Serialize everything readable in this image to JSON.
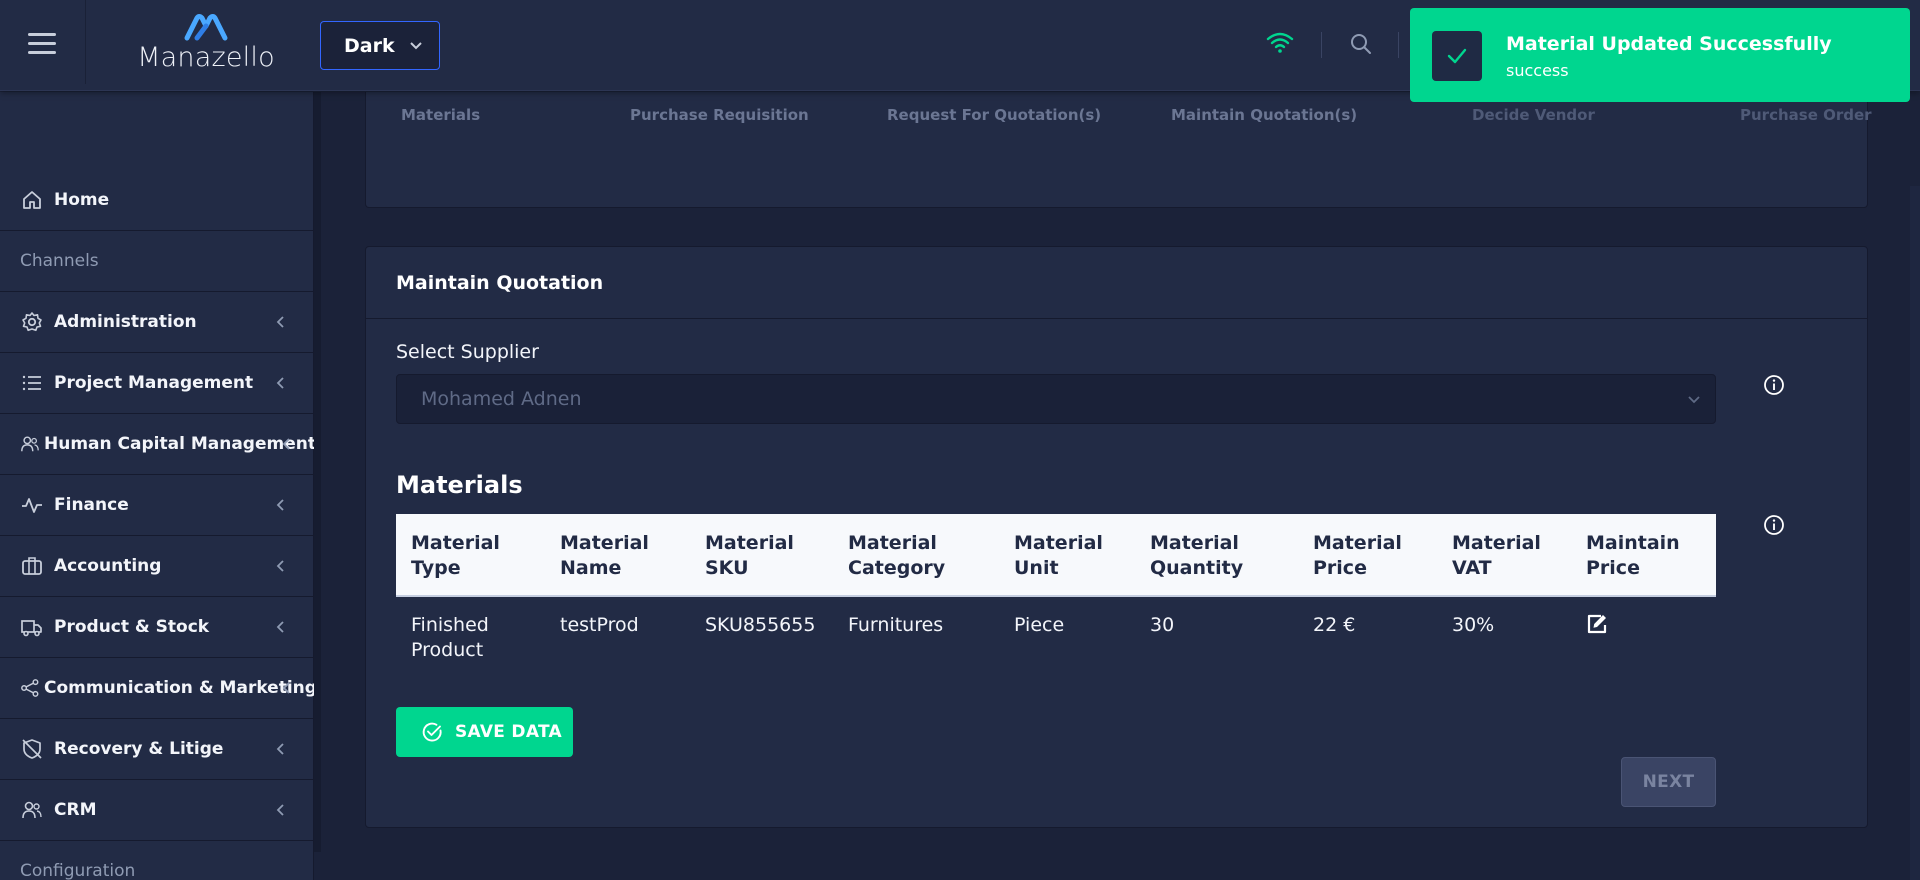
{
  "header": {
    "logo_text": "Manazello",
    "theme_label": "Dark"
  },
  "toast": {
    "title": "Material Updated Successfully",
    "message": "success",
    "color": "#00d68f"
  },
  "sidebar": {
    "items": [
      {
        "label": "Home",
        "icon": "home-icon"
      },
      {
        "label": "Channels",
        "icon": null
      },
      {
        "label": "Administration",
        "icon": "gear-icon"
      },
      {
        "label": "Project Management",
        "icon": "list-icon"
      },
      {
        "label": "Human Capital Management",
        "icon": "people-icon"
      },
      {
        "label": "Finance",
        "icon": "activity-icon"
      },
      {
        "label": "Accounting",
        "icon": "briefcase-icon"
      },
      {
        "label": "Product & Stock",
        "icon": "truck-icon"
      },
      {
        "label": "Communication & Marketing",
        "icon": "share-icon"
      },
      {
        "label": "Recovery & Litige",
        "icon": "shield-off-icon"
      },
      {
        "label": "CRM",
        "icon": "people-icon"
      },
      {
        "label": "Configuration",
        "icon": null
      }
    ]
  },
  "steps": [
    "Materials",
    "Purchase Requisition",
    "Request For Quotation(s)",
    "Maintain Quotation(s)",
    "Decide Vendor",
    "Purchase Order"
  ],
  "quotation": {
    "card_title": "Maintain Quotation",
    "supplier_label": "Select Supplier",
    "supplier_value": "Mohamed Adnen",
    "materials_title": "Materials",
    "columns": [
      [
        "Material",
        "Type"
      ],
      [
        "Material",
        "Name"
      ],
      [
        "Material",
        "SKU"
      ],
      [
        "Material",
        "Category"
      ],
      [
        "Material",
        "Unit"
      ],
      [
        "Material",
        "Quantity"
      ],
      [
        "Material",
        "Price"
      ],
      [
        "Material",
        "VAT"
      ],
      [
        "Maintain",
        "Price"
      ]
    ],
    "rows": [
      {
        "type": [
          "Finished",
          "Product"
        ],
        "name": "testProd",
        "sku": "SKU855655",
        "category": "Furnitures",
        "unit": "Piece",
        "quantity": "30",
        "price": "22 €",
        "vat": "30%"
      }
    ],
    "save_label": "SAVE DATA",
    "next_label": "NEXT"
  },
  "colors": {
    "background": "#1b2239",
    "surface": "#222b45",
    "primary": "#3366ff",
    "success": "#00d68f"
  }
}
